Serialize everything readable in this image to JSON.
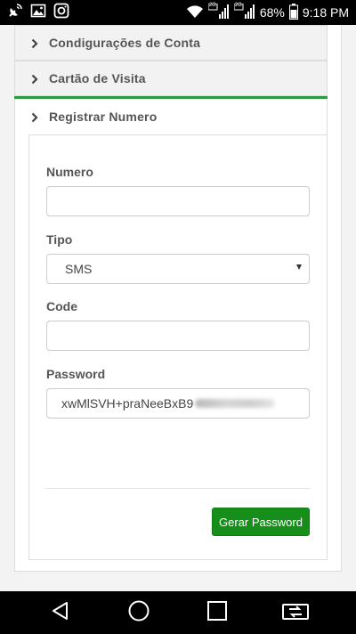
{
  "status_bar": {
    "battery_percent": "68%",
    "time": "9:18 PM",
    "network_label_1": "2G",
    "network_label_2": "2G",
    "icons": [
      "satellite-dish-icon",
      "gallery-icon",
      "instagram-icon",
      "wifi-icon",
      "signal-icon",
      "signal-icon",
      "battery-icon"
    ]
  },
  "accordion": {
    "items": [
      {
        "label": "Condigurações de Conta"
      },
      {
        "label": "Cartão de Visita"
      },
      {
        "label": "Registrar Numero"
      }
    ],
    "active_color": "#2e9a3e"
  },
  "form": {
    "numero_label": "Numero",
    "numero_value": "",
    "tipo_label": "Tipo",
    "tipo_value": "SMS",
    "code_label": "Code",
    "code_value": "",
    "password_label": "Password",
    "password_value": "xwMlSVH+praNeeBxB9",
    "generate_button": "Gerar Password",
    "button_color": "#168f1a"
  },
  "nav_bar": {
    "icons": [
      "back-icon",
      "home-icon",
      "recents-icon",
      "screen-mirror-icon"
    ]
  }
}
